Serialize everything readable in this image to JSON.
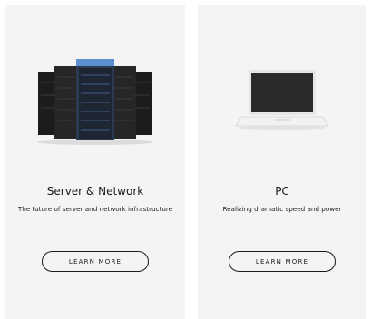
{
  "cards": [
    {
      "title": "Server & Network",
      "description": "The future of server and network infrastructure",
      "button_label": "LEARN MORE",
      "image": "server-rack-icon"
    },
    {
      "title": "PC",
      "description": "Realizing dramatic speed and power",
      "button_label": "LEARN MORE",
      "image": "laptop-icon"
    }
  ],
  "colors": {
    "card_background": "#f4f4f4",
    "text": "#1a1a1a",
    "server_highlight": "#4a78b8"
  }
}
